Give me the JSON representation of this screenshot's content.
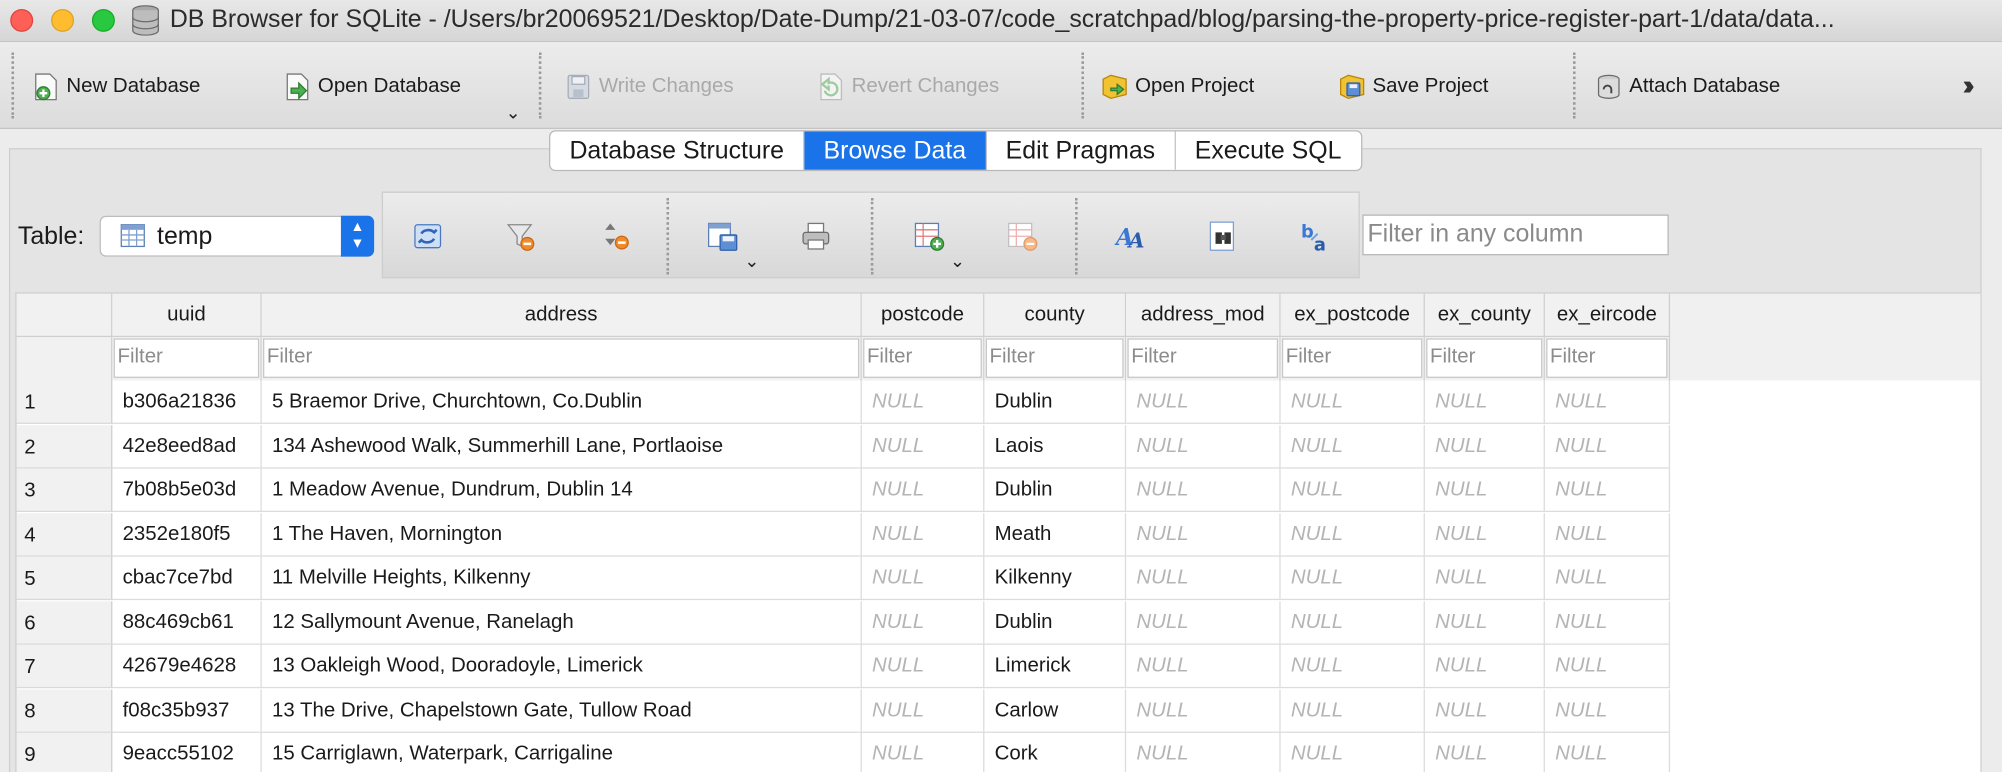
{
  "window": {
    "title": "DB Browser for SQLite - /Users/br20069521/Desktop/Date-Dump/21-03-07/code_scratchpad/blog/parsing-the-property-price-register-part-1/data/data..."
  },
  "toolbar": {
    "new_database": "New Database",
    "open_database": "Open Database",
    "write_changes": "Write Changes",
    "revert_changes": "Revert Changes",
    "open_project": "Open Project",
    "save_project": "Save Project",
    "attach_database": "Attach Database"
  },
  "tabs": [
    "Database Structure",
    "Browse Data",
    "Edit Pragmas",
    "Execute SQL"
  ],
  "browse": {
    "table_label": "Table:",
    "table_value": "temp",
    "filter_any_placeholder": "Filter in any column"
  },
  "grid": {
    "columns": [
      "uuid",
      "address",
      "postcode",
      "county",
      "address_mod",
      "ex_postcode",
      "ex_county",
      "ex_eircode"
    ],
    "filter_placeholder": "Filter",
    "null_text": "NULL",
    "rows": [
      {
        "n": "1",
        "uuid": "b306a21836",
        "address": "5 Braemor Drive, Churchtown, Co.Dublin",
        "county": "Dublin"
      },
      {
        "n": "2",
        "uuid": "42e8eed8ad",
        "address": "134 Ashewood Walk, Summerhill Lane, Portlaoise",
        "county": "Laois"
      },
      {
        "n": "3",
        "uuid": "7b08b5e03d",
        "address": "1 Meadow Avenue, Dundrum, Dublin 14",
        "county": "Dublin"
      },
      {
        "n": "4",
        "uuid": "2352e180f5",
        "address": "1 The Haven, Mornington",
        "county": "Meath"
      },
      {
        "n": "5",
        "uuid": "cbac7ce7bd",
        "address": "11 Melville Heights, Kilkenny",
        "county": "Kilkenny"
      },
      {
        "n": "6",
        "uuid": "88c469cb61",
        "address": "12 Sallymount Avenue, Ranelagh",
        "county": "Dublin"
      },
      {
        "n": "7",
        "uuid": "42679e4628",
        "address": "13  Oakleigh Wood, Dooradoyle, Limerick",
        "county": "Limerick"
      },
      {
        "n": "8",
        "uuid": "f08c35b937",
        "address": "13 The Drive, Chapelstown Gate, Tullow Road",
        "county": "Carlow"
      },
      {
        "n": "9",
        "uuid": "9eacc55102",
        "address": "15 Carriglawn, Waterpark, Carrigaline",
        "county": "Cork"
      }
    ]
  }
}
